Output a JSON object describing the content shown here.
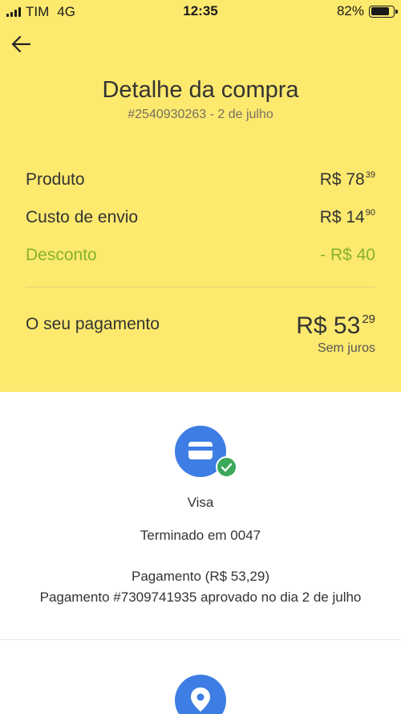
{
  "status_bar": {
    "carrier": "TIM",
    "network": "4G",
    "time": "12:35",
    "battery": "82%",
    "battery_level": 0.82
  },
  "header": {
    "title": "Detalhe da compra",
    "subtitle": "#2540930263 - 2 de julho"
  },
  "breakdown": [
    {
      "label": "Produto",
      "amount_main": "R$ 78",
      "amount_cents": "39"
    },
    {
      "label": "Custo de envio",
      "amount_main": "R$ 14",
      "amount_cents": "90"
    },
    {
      "label": "Desconto",
      "amount_main": "- R$ 40",
      "amount_cents": ""
    }
  ],
  "total": {
    "label": "O seu pagamento",
    "amount_main": "R$ 53",
    "amount_cents": "29",
    "note": "Sem juros"
  },
  "payment": {
    "method": "Visa",
    "card_ending": "Terminado em 0047",
    "payment_line": "Pagamento (R$ 53,29)",
    "approval_line": "Pagamento #7309741935 aprovado no dia 2 de julho"
  },
  "colors": {
    "header_bg": "#fde96e",
    "discount": "#86b22e",
    "icon_blue": "#3e7de3",
    "check_green": "#3ba85a"
  },
  "icons": {
    "back": "arrow-left-icon",
    "payment": "credit-card-icon",
    "approved": "check-icon",
    "location": "location-pin-icon"
  }
}
